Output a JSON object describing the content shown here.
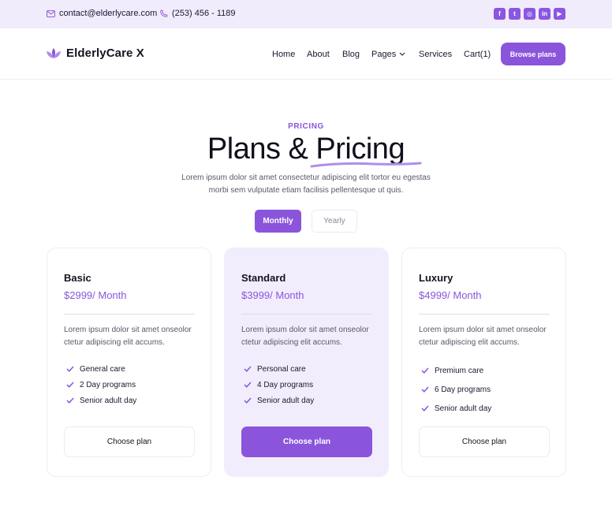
{
  "topbar": {
    "email": "contact@elderlycare.com",
    "phone": "(253) 456 - 1189",
    "socials": [
      {
        "icon": "facebook-icon",
        "glyph": "f"
      },
      {
        "icon": "twitter-icon",
        "glyph": "t"
      },
      {
        "icon": "instagram-icon",
        "glyph": "◎"
      },
      {
        "icon": "linkedin-icon",
        "glyph": "in"
      },
      {
        "icon": "youtube-icon",
        "glyph": "▶"
      }
    ]
  },
  "nav": {
    "brand": "ElderlyCare X",
    "items": [
      "Home",
      "About",
      "Blog",
      "Pages",
      "Services",
      "Cart(1)"
    ],
    "cta": "Browse plans"
  },
  "hero": {
    "eyebrow": "PRICING",
    "title": "Plans & Pricing",
    "description": "Lorem ipsum dolor sit amet consectetur adipiscing elit tortor eu egestas morbi sem vulputate etiam facilisis pellentesque ut quis."
  },
  "toggle": {
    "monthly": "Monthly",
    "yearly": "Yearly",
    "selected": "Monthly"
  },
  "plans": [
    {
      "name": "Basic",
      "price": "$2999/ Month",
      "description": "Lorem ipsum dolor sit amet onseolor ctetur adipiscing elit accums.",
      "features": [
        "General care",
        "2 Day programs",
        "Senior adult day"
      ],
      "cta": "Choose plan"
    },
    {
      "name": "Standard",
      "price": "$3999/ Month",
      "description": "Lorem ipsum dolor sit amet onseolor ctetur adipiscing elit accums.",
      "features": [
        "Personal care",
        "4 Day programs",
        "Senior adult day"
      ],
      "cta": "Choose plan"
    },
    {
      "name": "Luxury",
      "price": "$4999/ Month",
      "description": "Lorem ipsum dolor sit amet onseolor ctetur adipiscing elit accums.",
      "features": [
        "Premium care",
        "6 Day programs",
        "Senior adult day"
      ],
      "cta": "Choose plan"
    }
  ],
  "colors": {
    "accent": "#8a55db",
    "topbar_bg": "#f1ecfc",
    "featured_bg": "#f2edfc"
  }
}
